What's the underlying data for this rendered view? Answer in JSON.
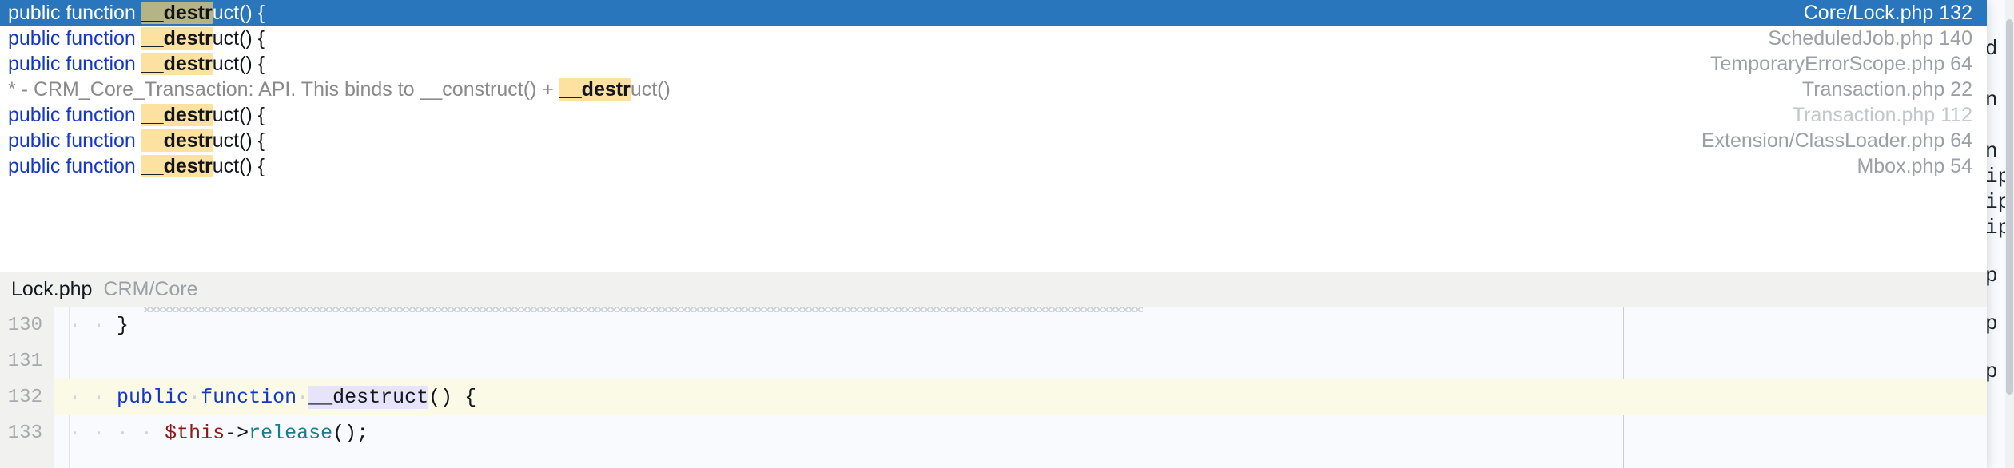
{
  "popup": {
    "name": "search-everywhere-results",
    "accent_selected_bg": "#2a76bd",
    "match_highlight_bg": "#fde1a0",
    "results": [
      {
        "prefix": "public function ",
        "match": "__destr",
        "suffix": "uct() {",
        "path": "Core/Lock.php 132",
        "selected": true,
        "comment": false,
        "dim_path": false
      },
      {
        "prefix": "public function ",
        "match": "__destr",
        "suffix": "uct() {",
        "path": "ScheduledJob.php 140",
        "selected": false,
        "comment": false,
        "dim_path": false
      },
      {
        "prefix": "public function ",
        "match": "__destr",
        "suffix": "uct() {",
        "path": "TemporaryErrorScope.php 64",
        "selected": false,
        "comment": false,
        "dim_path": false
      },
      {
        "prefix": "*  - CRM_Core_Transaction: API. This binds to __construct() + ",
        "match": "__destr",
        "suffix": "uct()",
        "path": "Transaction.php 22",
        "selected": false,
        "comment": true,
        "dim_path": false
      },
      {
        "prefix": "public function ",
        "match": "__destr",
        "suffix": "uct() {",
        "path": "Transaction.php 112",
        "selected": false,
        "comment": false,
        "dim_path": true
      },
      {
        "prefix": "public function ",
        "match": "__destr",
        "suffix": "uct() {",
        "path": "Extension/ClassLoader.php 64",
        "selected": false,
        "comment": false,
        "dim_path": false
      },
      {
        "prefix": "public function ",
        "match": "__destr",
        "suffix": "uct() {",
        "path": "Mbox.php 54",
        "selected": false,
        "comment": false,
        "dim_path": false
      }
    ]
  },
  "preview": {
    "file_name": "Lock.php",
    "directory": "CRM/Core",
    "lines": [
      {
        "number": "130",
        "highlighted": false
      },
      {
        "number": "131",
        "highlighted": false
      },
      {
        "number": "132",
        "highlighted": true
      },
      {
        "number": "133",
        "highlighted": false
      }
    ],
    "code": {
      "l130_text": "}",
      "l131_text": "",
      "l132_kw1": "public",
      "l132_kw2": "function",
      "l132_ident": "__destruct",
      "l132_tail": "() {",
      "l133_var": "$this",
      "l133_arrow": "->",
      "l133_meth": "release",
      "l133_tail": "();"
    }
  },
  "background_editor": {
    "visible_fragments": [
      "d",
      "n",
      "n",
      "ip",
      "ip",
      "ip",
      "p",
      "p",
      "p"
    ]
  }
}
